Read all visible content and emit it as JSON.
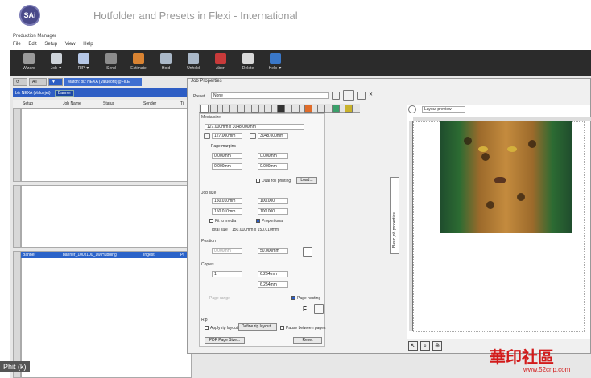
{
  "video": {
    "title": "Hotfolder and Presets in Flexi - International",
    "logo_text": "SAi",
    "caption": "Phit (k)",
    "watermark": "華印社區",
    "watermark_url": "www.52cnp.com"
  },
  "app": {
    "title": "Production Manager",
    "menu": [
      "File",
      "Edit",
      "Setup",
      "View",
      "Help"
    ]
  },
  "toolbar": [
    {
      "label": "Wizard",
      "color": "#9a9a9a"
    },
    {
      "label": "Job ▼",
      "color": "#cfd4da"
    },
    {
      "label": "RIP ▼",
      "color": "#b5c7e6"
    },
    {
      "label": "Send",
      "color": "#8c8c8c"
    },
    {
      "label": "Estimate",
      "color": "#d98332"
    },
    {
      "label": "Hold",
      "color": "#aab8c8"
    },
    {
      "label": "Unhold",
      "color": "#aab8c8"
    },
    {
      "label": "Abort",
      "color": "#c83a3a"
    },
    {
      "label": "Delete",
      "color": "#d9d9d9"
    },
    {
      "label": "Help ▼",
      "color": "#3a78c9"
    }
  ],
  "tabs": {
    "all": "All",
    "match": "Match: biz NEXA (Valueoht)@FILE"
  },
  "queue": {
    "printer": "biz NEXA (Valuejet)",
    "dropdown": "Banner",
    "columns": [
      "Setup",
      "Job Name",
      "Status",
      "Sender",
      "Ti"
    ],
    "row": {
      "setup": "Banner",
      "job": "banner_100x100_1w Hubbing",
      "status": "Ingest",
      "sender": "Pr"
    },
    "lane1": "Setup",
    "lane2": "RIP"
  },
  "dialog": {
    "title": "Job Properties",
    "preset_label": "Preset",
    "preset_value": "None",
    "media_label": "Media size",
    "media_value": "127.000mm x 3048.000mm",
    "width": "127.000mm",
    "height": "3048.000mm",
    "margins_label": "Page margins",
    "m1": "0.000mm",
    "m2": "0.000mm",
    "m3": "0.000mm",
    "m4": "0.000mm",
    "dual_roll": "Dual roll printing",
    "load": "Load...",
    "job_size": "Job size",
    "js_w": "150.010mm",
    "js_pct": "100.000",
    "js_h": "150.010mm",
    "js_pct2": "100.000",
    "fit_media": "Fit to media",
    "proportional": "Proportional",
    "total_label": "Total size",
    "total_value": "150.010mm x 150.010mm",
    "position_label": "Position",
    "pos_x": "0.000mm",
    "pos_y": "50.000mm",
    "copies_label": "Copies",
    "copies": "1",
    "gap1": "6.254mm",
    "gap2": "6.254mm",
    "page_range": "Page range",
    "page_nesting": "Page nesting",
    "rip_label": "Rip",
    "apply_layout": "Apply rip layout",
    "define_layout": "Define rip layout...",
    "pause_pages": "Pause between pages",
    "pdf_page": "PDF Page Size...",
    "reset": "Reset",
    "layout_preview": "Layout preview",
    "tab_strip": "Basic job properties"
  }
}
